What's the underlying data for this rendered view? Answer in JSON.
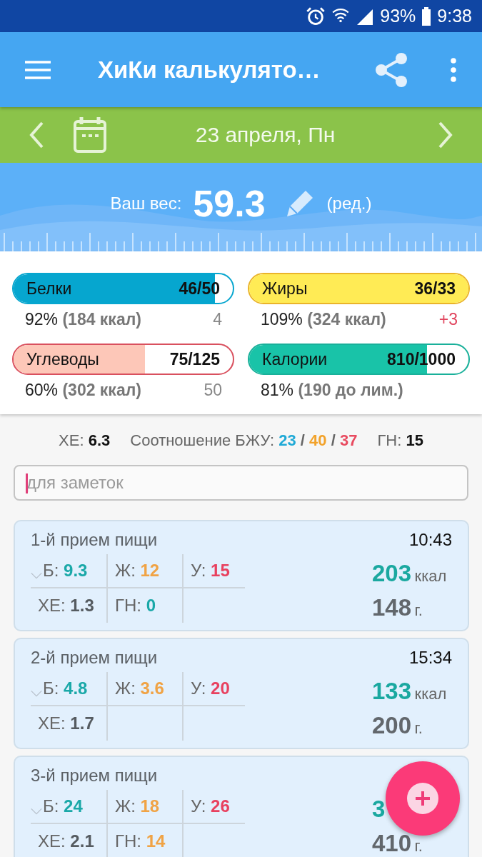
{
  "status_bar": {
    "battery": "93%",
    "time": "9:38"
  },
  "toolbar": {
    "title": "ХиКи калькулято…"
  },
  "date_bar": {
    "date": "23 апреля, Пн"
  },
  "weight": {
    "label": "Ваш вес:",
    "value": "59.3",
    "edit": "(ред.)"
  },
  "goals": [
    {
      "name": "Белки",
      "amount": "46/50",
      "level": 0.92,
      "color": "#06a6cf",
      "outline": {
        "color": "#06a6cf"
      },
      "percent": "92%",
      "detail": "(184 ккал)",
      "remainder": {
        "value": "4",
        "color": "#888888"
      }
    },
    {
      "name": "Жиры",
      "amount": "36/33",
      "level": 1,
      "color": "#ffeb55",
      "outline": {
        "color": "#eab42a"
      },
      "percent": "109%",
      "detail": "(324 ккал)",
      "remainder": {
        "value": "+3",
        "color": "#e0435c"
      }
    },
    {
      "name": "Углеводы",
      "amount": "75/125",
      "level": 0.6,
      "color": "#fdc7b8",
      "outline": {
        "color": "#d9505e"
      },
      "percent": "60%",
      "detail": "(302 ккал)",
      "remainder": {
        "value": "50",
        "color": "#888888"
      }
    },
    {
      "name": "Калории",
      "amount": "810/1000",
      "level": 0.81,
      "color": "#19c3a8",
      "outline": {
        "color": "#19b09a"
      },
      "percent": "81%",
      "detail": "(190 до лим.)"
    }
  ],
  "summary": {
    "xe": {
      "label": "ХЕ:",
      "value": "6.3"
    },
    "ratio": {
      "label": "Соотношение БЖУ:",
      "parts": [
        {
          "value": "23",
          "color": "#1fa9d6"
        },
        {
          "value": "40",
          "color": "#f2a22a"
        },
        {
          "value": "37",
          "color": "#e84a5f"
        }
      ],
      "separator": "/"
    },
    "gn": {
      "label": "ГН:",
      "value": "15"
    }
  },
  "notes": {
    "placeholder": "для заметок"
  },
  "meals": [
    {
      "title": "1-й прием пищи",
      "time": "10:43",
      "cells": [
        {
          "label": "Б:",
          "value": "9.3",
          "color": "#1aa8a8"
        },
        {
          "label": "Ж:",
          "value": "12",
          "color": "#f0a345"
        },
        {
          "label": "У:",
          "value": "15",
          "color": "#e8415f"
        },
        {
          "label": "ХЕ:",
          "value": "1.3",
          "color": "#555b60"
        },
        {
          "label": "ГН:",
          "value": "0",
          "color": "#1aa8a8"
        }
      ],
      "kcal": "203",
      "kcal_unit": "ккал",
      "grams": "148",
      "grams_unit": "г."
    },
    {
      "title": "2-й прием пищи",
      "time": "15:34",
      "cells": [
        {
          "label": "Б:",
          "value": "4.8",
          "color": "#1aa8a8"
        },
        {
          "label": "Ж:",
          "value": "3.6",
          "color": "#f0a345"
        },
        {
          "label": "У:",
          "value": "20",
          "color": "#e8415f"
        },
        {
          "label": "ХЕ:",
          "value": "1.7",
          "color": "#555b60"
        }
      ],
      "kcal": "133",
      "kcal_unit": "ккал",
      "grams": "200",
      "grams_unit": "г."
    },
    {
      "title": "3-й прием пищи",
      "cells": [
        {
          "label": "Б:",
          "value": "24",
          "color": "#1aa8a8"
        },
        {
          "label": "Ж:",
          "value": "18",
          "color": "#f0a345"
        },
        {
          "label": "У:",
          "value": "26",
          "color": "#e8415f"
        },
        {
          "label": "ХЕ:",
          "value": "2.1",
          "color": "#555b60"
        },
        {
          "label": "ГН:",
          "value": "14",
          "color": "#f0a345"
        }
      ],
      "kcal": "3",
      "grams": "410",
      "grams_unit": "г."
    }
  ]
}
